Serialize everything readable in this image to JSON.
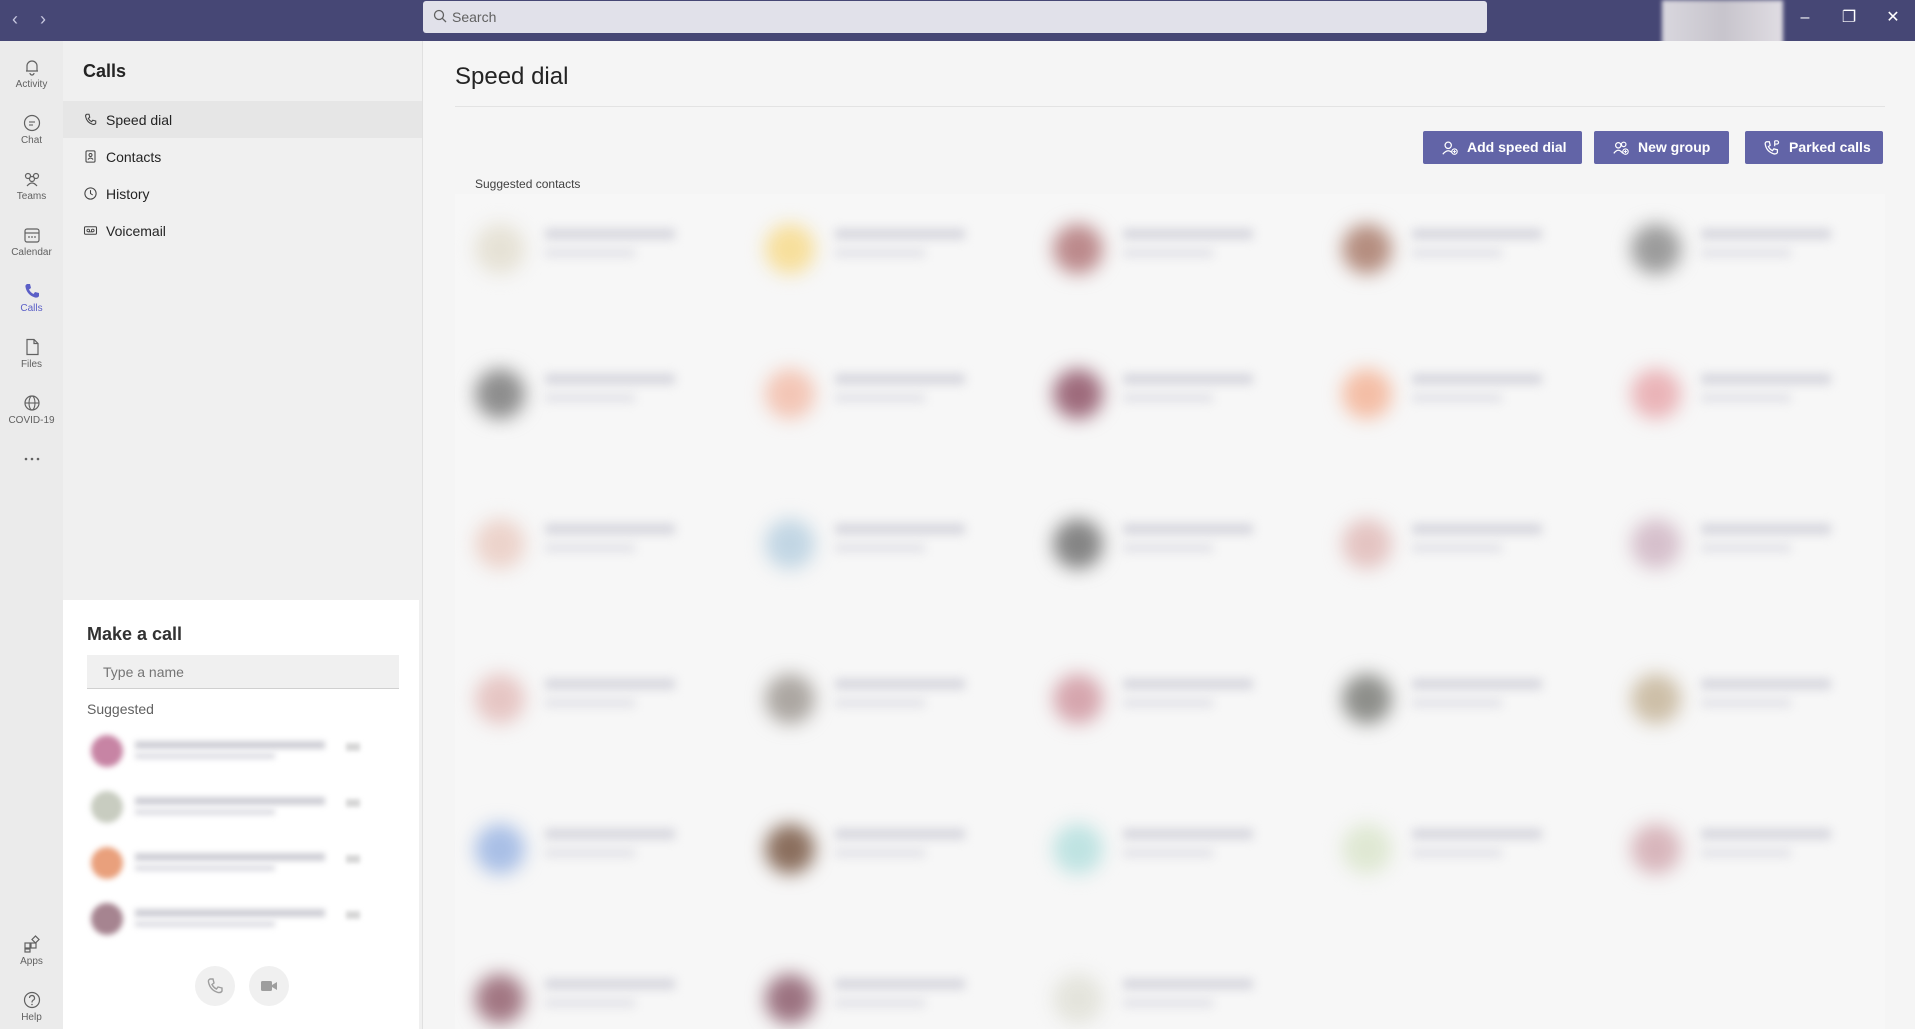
{
  "titlebar": {
    "search_placeholder": "Search",
    "back_icon": "chevron-left-icon",
    "forward_icon": "chevron-right-icon"
  },
  "rail": [
    {
      "label": "Activity",
      "icon": "bell-icon"
    },
    {
      "label": "Chat",
      "icon": "chat-icon"
    },
    {
      "label": "Teams",
      "icon": "teams-icon"
    },
    {
      "label": "Calendar",
      "icon": "calendar-icon"
    },
    {
      "label": "Calls",
      "icon": "phone-icon",
      "active": true
    },
    {
      "label": "Files",
      "icon": "file-icon"
    },
    {
      "label": "COVID-19",
      "icon": "globe-icon"
    },
    {
      "label": "Apps",
      "icon": "apps-icon"
    },
    {
      "label": "Help",
      "icon": "help-icon"
    }
  ],
  "panel": {
    "title": "Calls",
    "nav": [
      "Speed dial",
      "Contacts",
      "History",
      "Voicemail"
    ],
    "active_nav": "Speed dial"
  },
  "make_call": {
    "title": "Make a call",
    "input_placeholder": "Type a name",
    "suggested_label": "Suggested"
  },
  "main": {
    "title": "Speed dial",
    "buttons": [
      "Add speed dial",
      "New group",
      "Parked calls"
    ],
    "section_label": "Suggested contacts"
  },
  "colors": {
    "titlebar": "#464775",
    "accent": "#6264a7",
    "active_icon": "#5b5fc7"
  }
}
